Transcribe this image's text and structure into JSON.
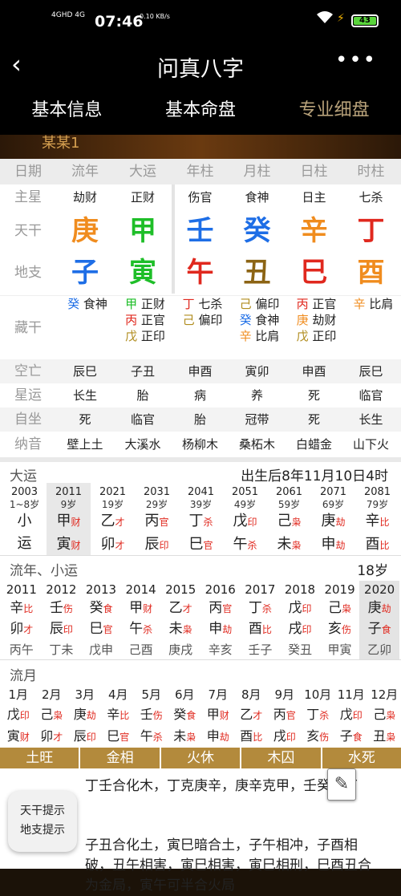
{
  "status": {
    "signal": "4GHD 4G",
    "time": "07:46",
    "speed": "0.10 KB/s",
    "battery": "43"
  },
  "nav": {
    "back": "‹",
    "title": "问真八字",
    "more": "•••"
  },
  "tabs": [
    "基本信息",
    "基本命盘",
    "专业细盘"
  ],
  "banner": "某某1",
  "chart": {
    "headers": [
      "日期",
      "流年",
      "大运",
      "年柱",
      "月柱",
      "日柱",
      "时柱"
    ],
    "zhuxing": {
      "label": "主星",
      "values": [
        "劫财",
        "正财",
        "伤官",
        "食神",
        "日主",
        "七杀"
      ]
    },
    "tiangan": {
      "label": "天干",
      "values": [
        "庚",
        "甲",
        "壬",
        "癸",
        "辛",
        "丁"
      ],
      "colors": [
        "#f08c1e",
        "#1ebe28",
        "#1e6ee6",
        "#1e6ee6",
        "#f08c1e",
        "#e0281e"
      ]
    },
    "dizhi": {
      "label": "地支",
      "values": [
        "子",
        "寅",
        "午",
        "丑",
        "巳",
        "酉"
      ],
      "colors": [
        "#1e6ee6",
        "#1ebe28",
        "#e0281e",
        "#8c6414",
        "#e0281e",
        "#f08c1e"
      ]
    },
    "canggan": {
      "label": "藏干",
      "cols": [
        [
          {
            "g": "癸",
            "s": "食神",
            "c": "#1e6ee6"
          }
        ],
        [
          {
            "g": "甲",
            "s": "正财",
            "c": "#1ebe28"
          },
          {
            "g": "丙",
            "s": "正官",
            "c": "#e0281e"
          },
          {
            "g": "戊",
            "s": "正印",
            "c": "#b08c1e"
          }
        ],
        [
          {
            "g": "丁",
            "s": "七杀",
            "c": "#e0281e"
          },
          {
            "g": "己",
            "s": "偏印",
            "c": "#b08c1e"
          }
        ],
        [
          {
            "g": "己",
            "s": "偏印",
            "c": "#b08c1e"
          },
          {
            "g": "癸",
            "s": "食神",
            "c": "#1e6ee6"
          },
          {
            "g": "辛",
            "s": "比肩",
            "c": "#f08c1e"
          }
        ],
        [
          {
            "g": "丙",
            "s": "正官",
            "c": "#e0281e"
          },
          {
            "g": "庚",
            "s": "劫财",
            "c": "#f08c1e"
          },
          {
            "g": "戊",
            "s": "正印",
            "c": "#b08c1e"
          }
        ],
        [
          {
            "g": "辛",
            "s": "比肩",
            "c": "#f08c1e"
          }
        ]
      ]
    },
    "kongwang": {
      "label": "空亡",
      "values": [
        "辰巳",
        "子丑",
        "申酉",
        "寅卯",
        "申酉",
        "辰巳"
      ]
    },
    "xingyun": {
      "label": "星运",
      "values": [
        "长生",
        "胎",
        "病",
        "养",
        "死",
        "临官"
      ]
    },
    "zizuo": {
      "label": "自坐",
      "values": [
        "死",
        "临官",
        "胎",
        "冠带",
        "死",
        "长生"
      ]
    },
    "nayin": {
      "label": "纳音",
      "values": [
        "壁上土",
        "大溪水",
        "杨柳木",
        "桑柘木",
        "白蜡金",
        "山下火"
      ]
    }
  },
  "dayun": {
    "label": "大运",
    "birth": "出生后8年11月10日4时",
    "items": [
      {
        "year": "2003",
        "age": "1~8岁",
        "g": "小",
        "gs": "",
        "z": "运",
        "zs": ""
      },
      {
        "year": "2011",
        "age": "9岁",
        "g": "甲",
        "gs": "财",
        "z": "寅",
        "zs": "财"
      },
      {
        "year": "2021",
        "age": "19岁",
        "g": "乙",
        "gs": "才",
        "z": "卯",
        "zs": "才"
      },
      {
        "year": "2031",
        "age": "29岁",
        "g": "丙",
        "gs": "官",
        "z": "辰",
        "zs": "印"
      },
      {
        "year": "2041",
        "age": "39岁",
        "g": "丁",
        "gs": "杀",
        "z": "巳",
        "zs": "官"
      },
      {
        "year": "2051",
        "age": "49岁",
        "g": "戊",
        "gs": "印",
        "z": "午",
        "zs": "杀"
      },
      {
        "year": "2061",
        "age": "59岁",
        "g": "己",
        "gs": "枭",
        "z": "未",
        "zs": "枭"
      },
      {
        "year": "2071",
        "age": "69岁",
        "g": "庚",
        "gs": "劫",
        "z": "申",
        "zs": "劫"
      },
      {
        "year": "2081",
        "age": "79岁",
        "g": "辛",
        "gs": "比",
        "z": "酉",
        "zs": "比"
      }
    ]
  },
  "liunian": {
    "label": "流年、小运",
    "age": "18岁",
    "items": [
      {
        "year": "2011",
        "g": "辛",
        "gs": "比",
        "z": "卯",
        "zs": "才",
        "x": "丙午"
      },
      {
        "year": "2012",
        "g": "壬",
        "gs": "伤",
        "z": "辰",
        "zs": "印",
        "x": "丁未"
      },
      {
        "year": "2013",
        "g": "癸",
        "gs": "食",
        "z": "巳",
        "zs": "官",
        "x": "戊申"
      },
      {
        "year": "2014",
        "g": "甲",
        "gs": "财",
        "z": "午",
        "zs": "杀",
        "x": "己酉"
      },
      {
        "year": "2015",
        "g": "乙",
        "gs": "才",
        "z": "未",
        "zs": "枭",
        "x": "庚戌"
      },
      {
        "year": "2016",
        "g": "丙",
        "gs": "官",
        "z": "申",
        "zs": "劫",
        "x": "辛亥"
      },
      {
        "year": "2017",
        "g": "丁",
        "gs": "杀",
        "z": "酉",
        "zs": "比",
        "x": "壬子"
      },
      {
        "year": "2018",
        "g": "戊",
        "gs": "印",
        "z": "戌",
        "zs": "印",
        "x": "癸丑"
      },
      {
        "year": "2019",
        "g": "己",
        "gs": "枭",
        "z": "亥",
        "zs": "伤",
        "x": "甲寅"
      },
      {
        "year": "2020",
        "g": "庚",
        "gs": "劫",
        "z": "子",
        "zs": "食",
        "x": "乙卯"
      }
    ]
  },
  "liuyue": {
    "label": "流月",
    "items": [
      {
        "m": "1月",
        "g": "戊",
        "gs": "印",
        "z": "寅",
        "zs": "财"
      },
      {
        "m": "2月",
        "g": "己",
        "gs": "枭",
        "z": "卯",
        "zs": "才"
      },
      {
        "m": "3月",
        "g": "庚",
        "gs": "劫",
        "z": "辰",
        "zs": "印"
      },
      {
        "m": "4月",
        "g": "辛",
        "gs": "比",
        "z": "巳",
        "zs": "官"
      },
      {
        "m": "5月",
        "g": "壬",
        "gs": "伤",
        "z": "午",
        "zs": "杀"
      },
      {
        "m": "6月",
        "g": "癸",
        "gs": "食",
        "z": "未",
        "zs": "枭"
      },
      {
        "m": "7月",
        "g": "甲",
        "gs": "财",
        "z": "申",
        "zs": "劫"
      },
      {
        "m": "8月",
        "g": "乙",
        "gs": "才",
        "z": "酉",
        "zs": "比"
      },
      {
        "m": "9月",
        "g": "丙",
        "gs": "官",
        "z": "戌",
        "zs": "印"
      },
      {
        "m": "10月",
        "g": "丁",
        "gs": "杀",
        "z": "亥",
        "zs": "伤"
      },
      {
        "m": "11月",
        "g": "戊",
        "gs": "印",
        "z": "子",
        "zs": "食"
      },
      {
        "m": "12月",
        "g": "己",
        "gs": "枭",
        "z": "丑",
        "zs": "枭"
      }
    ]
  },
  "seasons": [
    "土旺",
    "金相",
    "火休",
    "木囚",
    "水死"
  ],
  "hints": {
    "tiangan": "天干提示",
    "dizhi": "地支提示"
  },
  "relations": {
    "tiangan": "丁壬合化木，丁克庚辛，庚辛克甲，壬癸克丁",
    "dizhi": "子丑合化土，寅巳暗合土，子午相冲，子酉相破，丑午相害，寅巳相害，寅巳相刑，巳酉丑合为金局，寅午可半合火局"
  }
}
